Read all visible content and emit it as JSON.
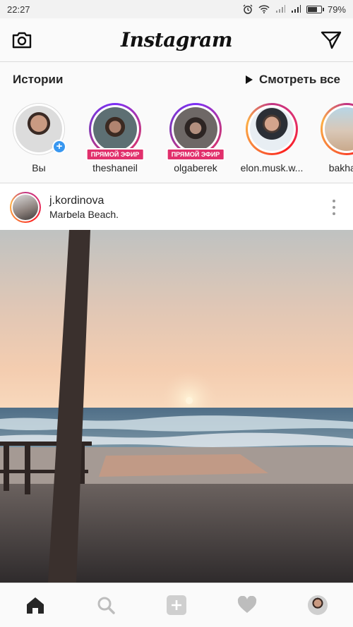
{
  "status_bar": {
    "time": "22:27",
    "battery_text": "79%",
    "battery_level": 0.79,
    "icons": [
      "alarm-icon",
      "wifi-icon",
      "signal-icon",
      "signal-icon",
      "battery-icon"
    ]
  },
  "top_bar": {
    "logo": "Instagram",
    "left_icon": "camera-icon",
    "right_icon": "direct-message-icon"
  },
  "stories": {
    "title": "Истории",
    "watch_all": "Смотреть все",
    "items": [
      {
        "name": "Вы",
        "ring": "none",
        "badge": "+"
      },
      {
        "name": "theshaneil",
        "ring": "live",
        "live_label": "ПРЯМОЙ ЭФИР"
      },
      {
        "name": "olgaberek",
        "ring": "live",
        "live_label": "ПРЯМОЙ ЭФИР"
      },
      {
        "name": "elon.musk.w...",
        "ring": "gradient"
      },
      {
        "name": "bakharn",
        "ring": "gradient"
      }
    ]
  },
  "post": {
    "username": "j.kordinova",
    "location": "Marbela Beach."
  },
  "bottom_nav": {
    "items": [
      "home-icon",
      "search-icon",
      "add-post-icon",
      "activity-heart-icon",
      "profile-avatar"
    ]
  },
  "colors": {
    "accent_blue": "#3897f0",
    "live_pink": "#e1306c",
    "border": "#dbdbdb"
  }
}
